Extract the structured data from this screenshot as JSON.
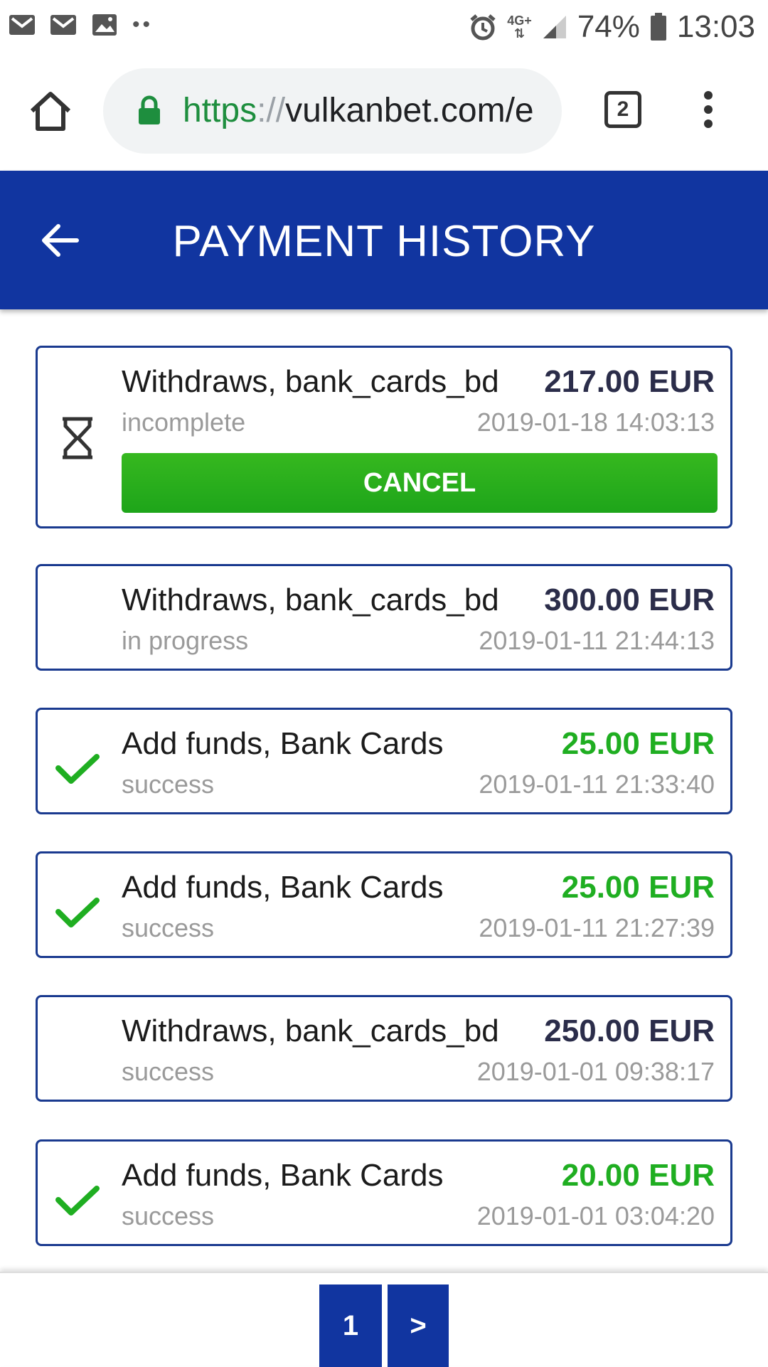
{
  "status_bar": {
    "left_icons": [
      "gmail-icon",
      "gmail-icon",
      "gallery-icon"
    ],
    "dots": "••",
    "network": "4G+",
    "battery_percent": "74%",
    "time": "13:03"
  },
  "browser": {
    "url_scheme": "https",
    "url_separator": "://",
    "url_host": "vulkanbet.com/e",
    "tab_count": "2"
  },
  "header": {
    "title": "PAYMENT HISTORY"
  },
  "colors": {
    "header_bg": "#1135a0",
    "card_border": "#1a3a8f",
    "amount_withdraw": "#2b2d4a",
    "amount_deposit": "#1fae21",
    "cancel_button": "#22a81b",
    "status_text": "#9a9a9a"
  },
  "transactions": [
    {
      "icon": "hourglass-icon",
      "title": "Withdraws, bank_cards_bd",
      "amount": "217.00 EUR",
      "amount_type": "withdraw",
      "status": "incomplete",
      "date": "2019-01-18 14:03:13",
      "action_label": "CANCEL"
    },
    {
      "icon": "",
      "title": "Withdraws, bank_cards_bd",
      "amount": "300.00 EUR",
      "amount_type": "withdraw",
      "status": "in progress",
      "date": "2019-01-11 21:44:13"
    },
    {
      "icon": "checkmark-icon",
      "title": "Add funds, Bank Cards",
      "amount": "25.00 EUR",
      "amount_type": "deposit",
      "status": "success",
      "date": "2019-01-11 21:33:40"
    },
    {
      "icon": "checkmark-icon",
      "title": "Add funds, Bank Cards",
      "amount": "25.00 EUR",
      "amount_type": "deposit",
      "status": "success",
      "date": "2019-01-11 21:27:39"
    },
    {
      "icon": "",
      "title": "Withdraws, bank_cards_bd",
      "amount": "250.00 EUR",
      "amount_type": "withdraw",
      "status": "success",
      "date": "2019-01-01 09:38:17"
    },
    {
      "icon": "checkmark-icon",
      "title": "Add funds, Bank Cards",
      "amount": "20.00 EUR",
      "amount_type": "deposit",
      "status": "success",
      "date": "2019-01-01 03:04:20"
    }
  ],
  "pagination": {
    "current_page": "1",
    "next_label": ">"
  }
}
